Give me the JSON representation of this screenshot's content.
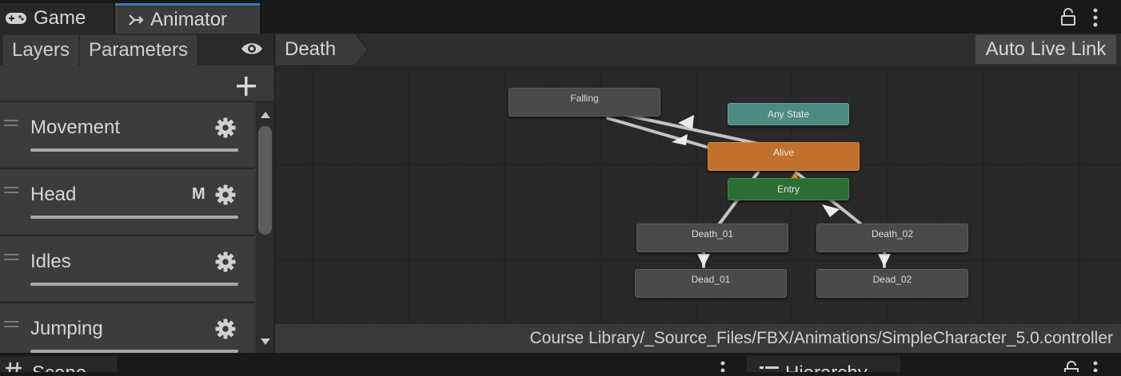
{
  "tabs": {
    "game": {
      "label": "Game",
      "icon": "gamepad-icon"
    },
    "animator": {
      "label": "Animator",
      "icon": "animator-icon"
    }
  },
  "left_panel": {
    "tabs": [
      "Layers",
      "Parameters"
    ],
    "layers": [
      {
        "name": "Movement",
        "mask_flag": ""
      },
      {
        "name": "Head",
        "mask_flag": "M"
      },
      {
        "name": "Idles",
        "mask_flag": ""
      },
      {
        "name": "Jumping",
        "mask_flag": ""
      }
    ]
  },
  "graph": {
    "breadcrumb": "Death",
    "auto_live_link": "Auto Live Link",
    "states": {
      "falling": "Falling",
      "any_state": "Any State",
      "alive": "Alive",
      "entry": "Entry",
      "death_01": "Death_01",
      "death_02": "Death_02",
      "dead_01": "Dead_01",
      "dead_02": "Dead_02"
    },
    "controller_path": "Course Library/_Source_Files/FBX/Animations/SimpleCharacter_5.0.controller"
  },
  "bottom_tabs": {
    "scene": "Scene",
    "hierarchy": "Hierarchy"
  },
  "colors": {
    "accent_tab": "#3a79bb",
    "any_state": "#4d8a82",
    "alive": "#c0702a",
    "entry": "#2c6e36"
  }
}
